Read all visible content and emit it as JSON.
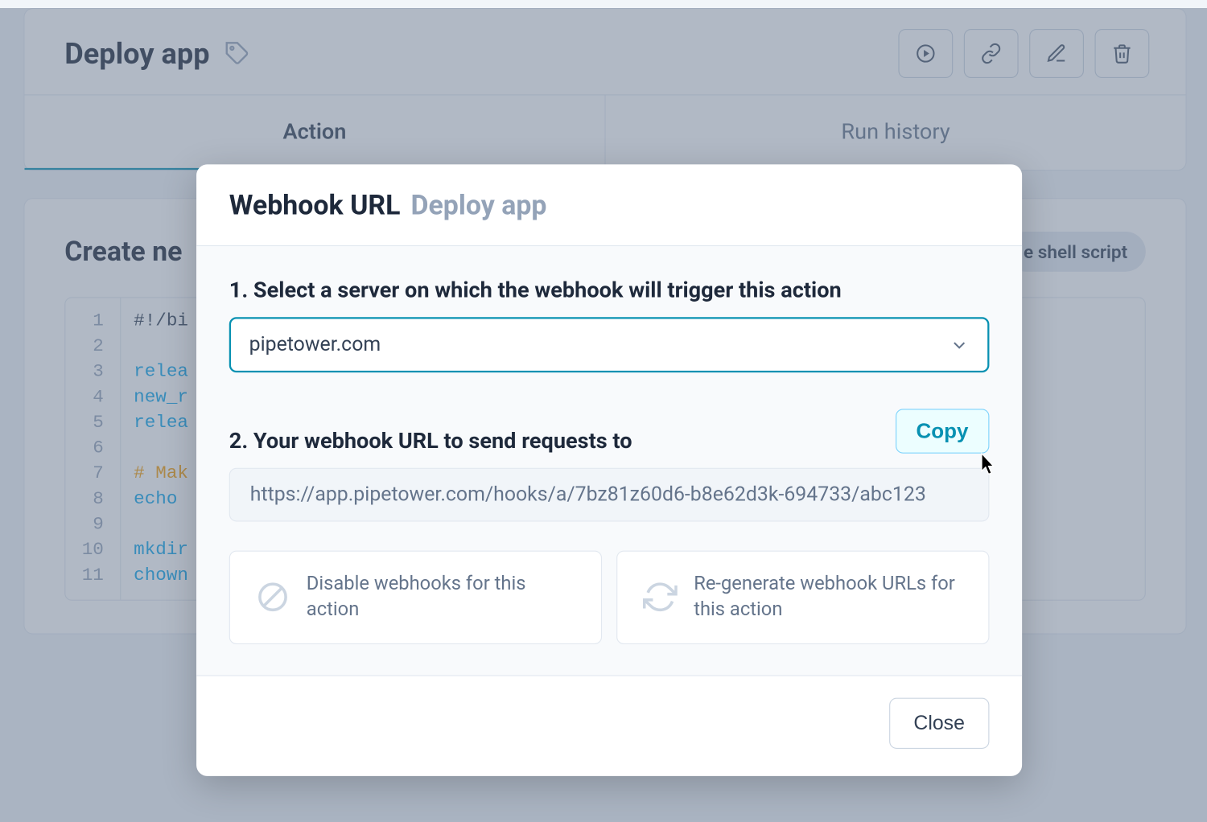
{
  "page": {
    "title": "Deploy app",
    "tabs": {
      "action": "Action",
      "history": "Run history"
    }
  },
  "section": {
    "title": "Create ne",
    "chip": "e shell script"
  },
  "code": {
    "lines": [
      "#!/bi",
      "",
      "relea",
      "new_r",
      "relea",
      "",
      "# Mak",
      "echo ",
      "",
      "mkdir",
      "chown"
    ]
  },
  "modal": {
    "title": "Webhook URL",
    "subtitle": "Deploy app",
    "step1_label": "1. Select a server on which the webhook will trigger this action",
    "server_selected": "pipetower.com",
    "step2_label": "2. Your webhook URL to send requests to",
    "copy_label": "Copy",
    "url": "https://app.pipetower.com/hooks/a/7bz81z60d6-b8e62d3k-694733/abc123",
    "disable_label": "Disable webhooks for this action",
    "regenerate_label": "Re-generate webhook URLs for this action",
    "close_label": "Close"
  }
}
